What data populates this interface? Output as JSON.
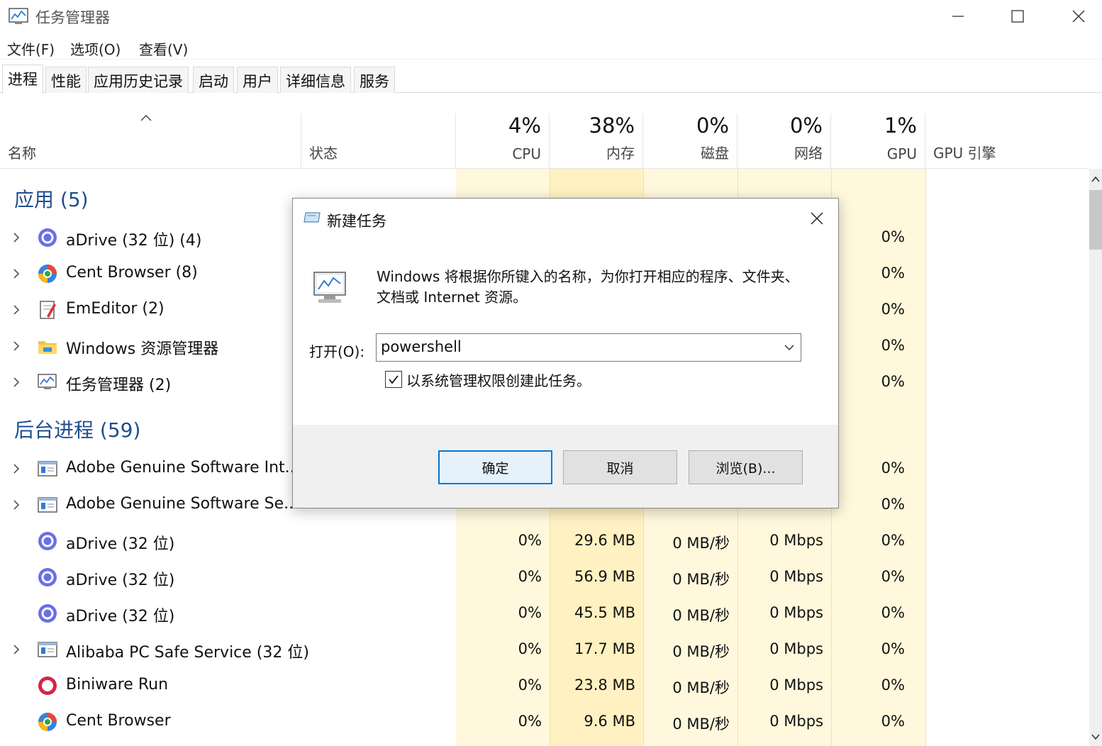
{
  "window": {
    "title": "任务管理器",
    "minimize_icon": "minimize-icon",
    "maximize_icon": "maximize-icon",
    "close_icon": "close-icon"
  },
  "menu": [
    "文件(F)",
    "选项(O)",
    "查看(V)"
  ],
  "tabs": [
    {
      "label": "进程",
      "active": true
    },
    {
      "label": "性能",
      "active": false
    },
    {
      "label": "应用历史记录",
      "active": false
    },
    {
      "label": "启动",
      "active": false
    },
    {
      "label": "用户",
      "active": false
    },
    {
      "label": "详细信息",
      "active": false
    },
    {
      "label": "服务",
      "active": false
    }
  ],
  "columns": {
    "name": "名称",
    "status": "状态",
    "cpu": {
      "pct": "4%",
      "label": "CPU"
    },
    "memory": {
      "pct": "38%",
      "label": "内存"
    },
    "disk": {
      "pct": "0%",
      "label": "磁盘"
    },
    "network": {
      "pct": "0%",
      "label": "网络"
    },
    "gpu": {
      "pct": "1%",
      "label": "GPU"
    },
    "gpu_engine": "GPU 引擎"
  },
  "groups": {
    "apps": "应用 (5)",
    "background": "后台进程 (59)"
  },
  "apps": [
    {
      "name": "aDrive (32 位) (4)",
      "icon": "adrive-icon",
      "gpu": "0%"
    },
    {
      "name": "Cent Browser (8)",
      "icon": "cent-browser-icon",
      "gpu": "0%"
    },
    {
      "name": "EmEditor (2)",
      "icon": "emeditor-icon",
      "gpu": "0%"
    },
    {
      "name": "Windows 资源管理器",
      "icon": "explorer-folder-icon",
      "gpu": "0%"
    },
    {
      "name": "任务管理器 (2)",
      "icon": "task-manager-icon",
      "gpu": "0%"
    }
  ],
  "background": [
    {
      "name": "Adobe Genuine Software Int...",
      "icon": "service-icon",
      "expandable": true,
      "cpu": "",
      "mem": "",
      "disk": "",
      "net": "",
      "gpu": "0%"
    },
    {
      "name": "Adobe Genuine Software Se...",
      "icon": "service-icon",
      "expandable": true,
      "cpu": "",
      "mem": "",
      "disk": "",
      "net": "",
      "gpu": "0%"
    },
    {
      "name": "aDrive (32 位)",
      "icon": "adrive-icon",
      "expandable": false,
      "cpu": "0%",
      "mem": "29.6 MB",
      "disk": "0 MB/秒",
      "net": "0 Mbps",
      "gpu": "0%"
    },
    {
      "name": "aDrive (32 位)",
      "icon": "adrive-icon",
      "expandable": false,
      "cpu": "0%",
      "mem": "56.9 MB",
      "disk": "0 MB/秒",
      "net": "0 Mbps",
      "gpu": "0%"
    },
    {
      "name": "aDrive (32 位)",
      "icon": "adrive-icon",
      "expandable": false,
      "cpu": "0%",
      "mem": "45.5 MB",
      "disk": "0 MB/秒",
      "net": "0 Mbps",
      "gpu": "0%"
    },
    {
      "name": "Alibaba PC Safe Service (32 位)",
      "icon": "service-icon",
      "expandable": true,
      "cpu": "0%",
      "mem": "17.7 MB",
      "disk": "0 MB/秒",
      "net": "0 Mbps",
      "gpu": "0%"
    },
    {
      "name": "Biniware Run",
      "icon": "biniware-icon",
      "expandable": false,
      "cpu": "0%",
      "mem": "23.8 MB",
      "disk": "0 MB/秒",
      "net": "0 Mbps",
      "gpu": "0%"
    },
    {
      "name": "Cent Browser",
      "icon": "cent-browser-icon",
      "expandable": false,
      "cpu": "0%",
      "mem": "9.6 MB",
      "disk": "0 MB/秒",
      "net": "0 Mbps",
      "gpu": "0%"
    }
  ],
  "dialog": {
    "title": "新建任务",
    "description": "Windows 将根据你所键入的名称，为你打开相应的程序、文件夹、文档或 Internet 资源。",
    "open_label": "打开(O):",
    "open_value": "powershell",
    "admin_checkbox_label": "以系统管理权限创建此任务。",
    "admin_checked": true,
    "ok": "确定",
    "cancel": "取消",
    "browse": "浏览(B)..."
  },
  "colors": {
    "group_title": "#1f4e8f",
    "column_highlight": "#fff8dc",
    "column_highlight_strong": "#fff1c1",
    "default_button_border": "#0078d7"
  }
}
